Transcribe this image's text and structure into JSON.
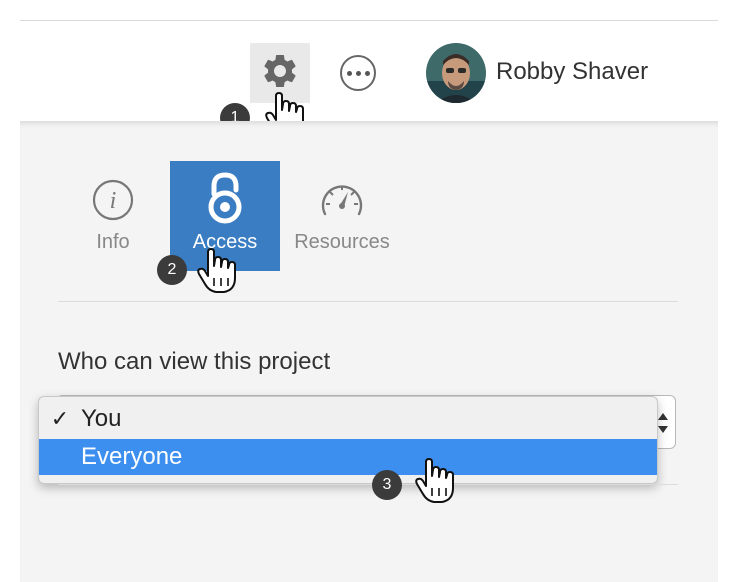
{
  "header": {
    "user_name": "Robby Shaver",
    "settings_icon": "gear-icon",
    "more_icon": "ellipsis-icon"
  },
  "tabs": [
    {
      "label": "Info",
      "icon": "info-icon",
      "active": false
    },
    {
      "label": "Access",
      "icon": "lock-icon",
      "active": true
    },
    {
      "label": "Resources",
      "icon": "speedometer-icon",
      "active": false
    }
  ],
  "access": {
    "field_label": "Who can view this project",
    "options": [
      {
        "label": "You",
        "checked": true
      },
      {
        "label": "Everyone",
        "highlighted": true
      }
    ]
  },
  "steps": [
    "1",
    "2",
    "3"
  ],
  "colors": {
    "accent": "#3a7dc2",
    "highlight": "#3c8fee",
    "panel": "#f4f4f4"
  }
}
